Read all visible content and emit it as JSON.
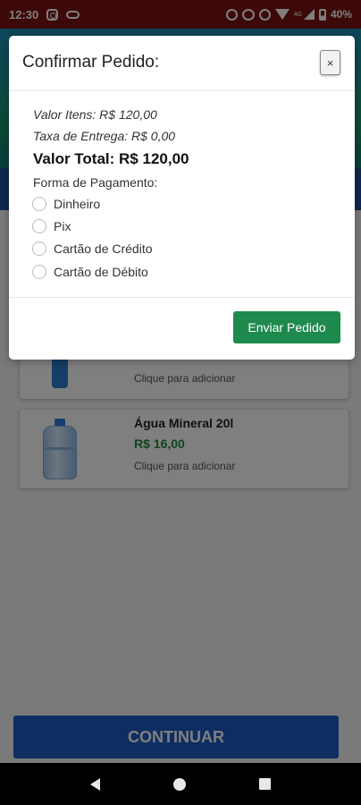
{
  "status_bar": {
    "time": "12:30",
    "network": "4G",
    "battery": "40%"
  },
  "products": [
    {
      "name": "",
      "price": "",
      "hint": "Clique para adicionar"
    },
    {
      "name": "Água Mineral 20l",
      "price": "R$ 16,00",
      "hint": "Clique para adicionar"
    }
  ],
  "continue_button": "CONTINUAR",
  "modal": {
    "title": "Confirmar Pedido:",
    "close": "×",
    "subtotal": "Valor Itens: R$ 120,00",
    "delivery": "Taxa de Entrega: R$ 0,00",
    "total": "Valor Total: R$ 120,00",
    "payment_label": "Forma de Pagamento:",
    "payment_options": [
      "Dinheiro",
      "Pix",
      "Cartão de Crédito",
      "Cartão de Débito"
    ],
    "submit": "Enviar Pedido"
  },
  "colors": {
    "status_bar": "#7a1210",
    "price_green": "#1f8a3c",
    "submit_green": "#1e8a4e",
    "continue_blue": "#1d5cc4"
  },
  "icons": {
    "status_left": [
      "instagram-icon",
      "link-icon"
    ],
    "status_right": [
      "alarm-icon",
      "data-saver-icon",
      "wifi-call-icon",
      "wifi-icon",
      "signal-icon",
      "battery-icon"
    ],
    "nav": [
      "back-icon",
      "home-icon",
      "recents-icon"
    ]
  }
}
